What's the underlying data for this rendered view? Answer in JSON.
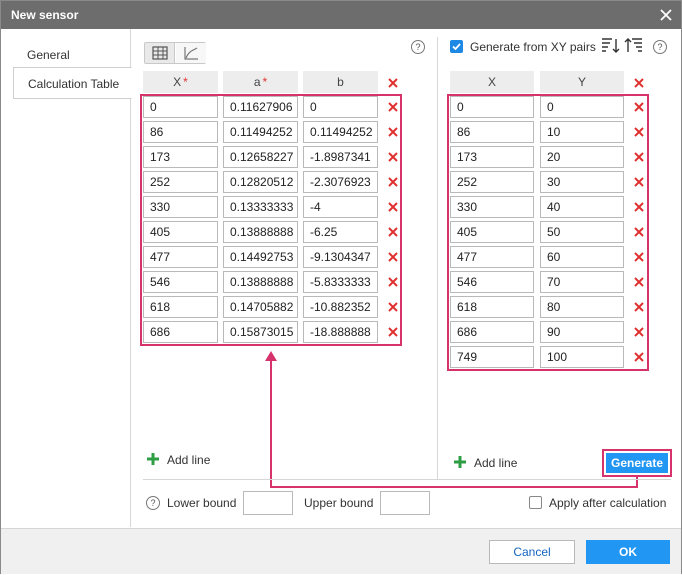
{
  "window": {
    "title": "New sensor"
  },
  "tabs": [
    "General",
    "Calculation Table"
  ],
  "calc_table": {
    "headers": {
      "x": "X",
      "a": "a",
      "b": "b"
    },
    "required_mark": "*",
    "rows": [
      {
        "x": "0",
        "a": "0.11627906",
        "b": "0"
      },
      {
        "x": "86",
        "a": "0.11494252",
        "b": "0.11494252"
      },
      {
        "x": "173",
        "a": "0.12658227",
        "b": "-1.8987341"
      },
      {
        "x": "252",
        "a": "0.12820512",
        "b": "-2.3076923"
      },
      {
        "x": "330",
        "a": "0.13333333",
        "b": "-4"
      },
      {
        "x": "405",
        "a": "0.13888888",
        "b": "-6.25"
      },
      {
        "x": "477",
        "a": "0.14492753",
        "b": "-9.1304347"
      },
      {
        "x": "546",
        "a": "0.13888888",
        "b": "-5.8333333"
      },
      {
        "x": "618",
        "a": "0.14705882",
        "b": "-10.882352"
      },
      {
        "x": "686",
        "a": "0.15873015",
        "b": "-18.888888"
      }
    ],
    "add_line": "Add line"
  },
  "xy_pairs": {
    "generate_label": "Generate from XY pairs",
    "checked": true,
    "headers": {
      "x": "X",
      "y": "Y"
    },
    "rows": [
      {
        "x": "0",
        "y": "0"
      },
      {
        "x": "86",
        "y": "10"
      },
      {
        "x": "173",
        "y": "20"
      },
      {
        "x": "252",
        "y": "30"
      },
      {
        "x": "330",
        "y": "40"
      },
      {
        "x": "405",
        "y": "50"
      },
      {
        "x": "477",
        "y": "60"
      },
      {
        "x": "546",
        "y": "70"
      },
      {
        "x": "618",
        "y": "80"
      },
      {
        "x": "686",
        "y": "90"
      },
      {
        "x": "749",
        "y": "100"
      }
    ],
    "add_line": "Add line",
    "generate_button": "Generate"
  },
  "bounds": {
    "lower_label": "Lower bound",
    "upper_label": "Upper bound",
    "lower_value": "",
    "upper_value": "",
    "apply_after_label": "Apply after calculation",
    "apply_after_checked": false
  },
  "footer": {
    "cancel": "Cancel",
    "ok": "OK"
  },
  "colors": {
    "accent": "#2196f3",
    "highlight": "#d6336c",
    "delete": "#e03131",
    "add": "#2e9e44",
    "titlebar": "#6d6d6d"
  },
  "icons": [
    "close-icon",
    "table-view-icon",
    "chart-view-icon",
    "help-icon",
    "delete-icon",
    "add-icon",
    "sort-descending-icon",
    "sort-ascending-icon",
    "checkbox-checked-icon"
  ]
}
